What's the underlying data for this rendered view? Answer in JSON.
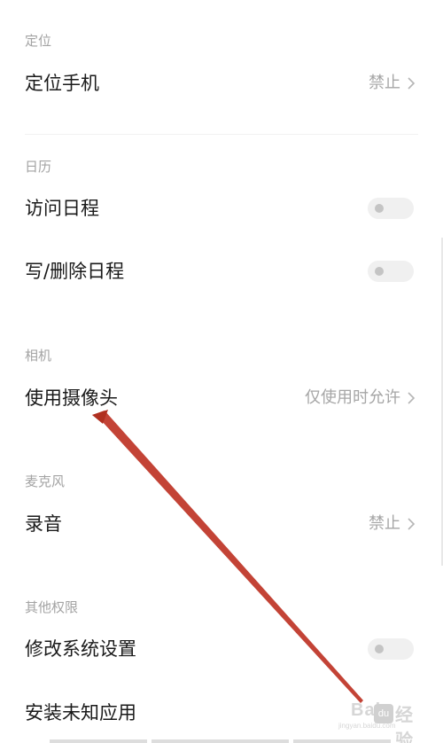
{
  "sections": [
    {
      "title": "定位",
      "rows": [
        {
          "label": "定位手机",
          "value": "禁止",
          "control": "chevron"
        }
      ]
    },
    {
      "title": "日历",
      "rows": [
        {
          "label": "访问日程",
          "control": "toggle",
          "state": "off"
        },
        {
          "label": "写/删除日程",
          "control": "toggle",
          "state": "off"
        }
      ]
    },
    {
      "title": "相机",
      "rows": [
        {
          "label": "使用摄像头",
          "value": "仅使用时允许",
          "control": "chevron"
        }
      ]
    },
    {
      "title": "麦克风",
      "rows": [
        {
          "label": "录音",
          "value": "禁止",
          "control": "chevron"
        }
      ]
    },
    {
      "title": "其他权限",
      "rows": [
        {
          "label": "修改系统设置",
          "control": "toggle",
          "state": "off"
        },
        {
          "label": "安装未知应用"
        }
      ]
    }
  ],
  "watermark": {
    "text": "Bai",
    "badge": "du",
    "suffix": "经验",
    "sub": "jingyan.baidu.com"
  },
  "colors": {
    "annotation_arrow": "#c0392b",
    "section_title": "#a3a3a3",
    "row_label": "#1a1a1a",
    "row_value": "#a6a6a6"
  },
  "icons": {
    "chevron": "chevron-right-icon",
    "toggle": "toggle-switch"
  }
}
